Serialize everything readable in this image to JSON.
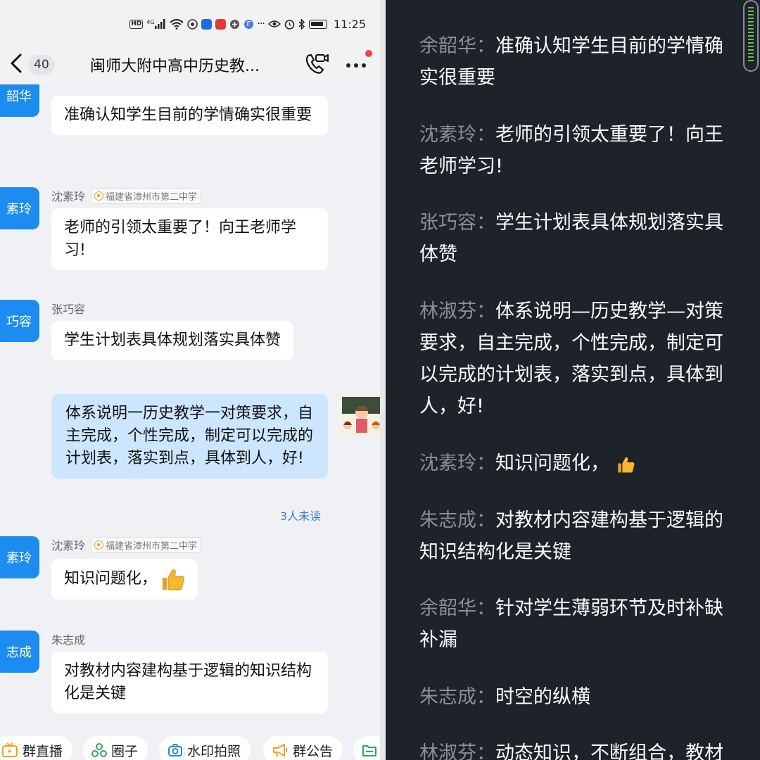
{
  "status_bar": {
    "network": "4G",
    "hd": "HD",
    "time": "11:25"
  },
  "header": {
    "unread_count": "40",
    "title": "闽师大附中高中历史教...",
    "icons": [
      "back-arrow-icon",
      "video-call-icon",
      "more-icon"
    ]
  },
  "messages": [
    {
      "avatar": "韶华",
      "text": "准确认知学生目前的学情确实很重要"
    },
    {
      "avatar": "素玲",
      "sender": "沈素玲",
      "org": "福建省漳州市第二中学",
      "text": "老师的引领太重要了！向王老师学习!"
    },
    {
      "avatar": "巧容",
      "sender": "张巧容",
      "text": "学生计划表具体规划落实具体赞"
    },
    {
      "mine": true,
      "text": "体系说明一历史教学一对策要求，自主完成，个性完成，制定可以完成的计划表，落实到点，具体到人，好!",
      "read_status": "3人未读"
    },
    {
      "avatar": "素玲",
      "sender": "沈素玲",
      "org": "福建省漳州市第二中学",
      "text": "知识问题化，"
    },
    {
      "avatar": "志成",
      "sender": "朱志成",
      "text": "对教材内容建构基于逻辑的知识结构化是关键"
    }
  ],
  "quick_actions": [
    "群直播",
    "圈子",
    "水印拍照",
    "群公告"
  ],
  "transcript": [
    {
      "speaker": "余韶华：",
      "text": "准确认知学生目前的学情确实很重要"
    },
    {
      "speaker": "沈素玲：",
      "text": "老师的引领太重要了！向王老师学习!"
    },
    {
      "speaker": "张巧容：",
      "text": "学生计划表具体规划落实具体赞"
    },
    {
      "speaker": "林淑芬：",
      "text": "体系说明—历史教学—对策要求，自主完成，个性完成，制定可以完成的计划表，落实到点，具体到人，好!"
    },
    {
      "speaker": "沈素玲：",
      "text": "知识问题化，"
    },
    {
      "speaker": "朱志成：",
      "text": "对教材内容建构基于逻辑的知识结构化是关键"
    },
    {
      "speaker": "余韶华：",
      "text": "针对学生薄弱环节及时补缺补漏"
    },
    {
      "speaker": "朱志成：",
      "text": "时空的纵横"
    },
    {
      "speaker": "林淑芬：",
      "text": "动态知识，不断组合，教材"
    }
  ],
  "colors": {
    "accent": "#1d8cf0",
    "my_bubble": "#cde6ff",
    "dark_bg": "#1e2229"
  }
}
